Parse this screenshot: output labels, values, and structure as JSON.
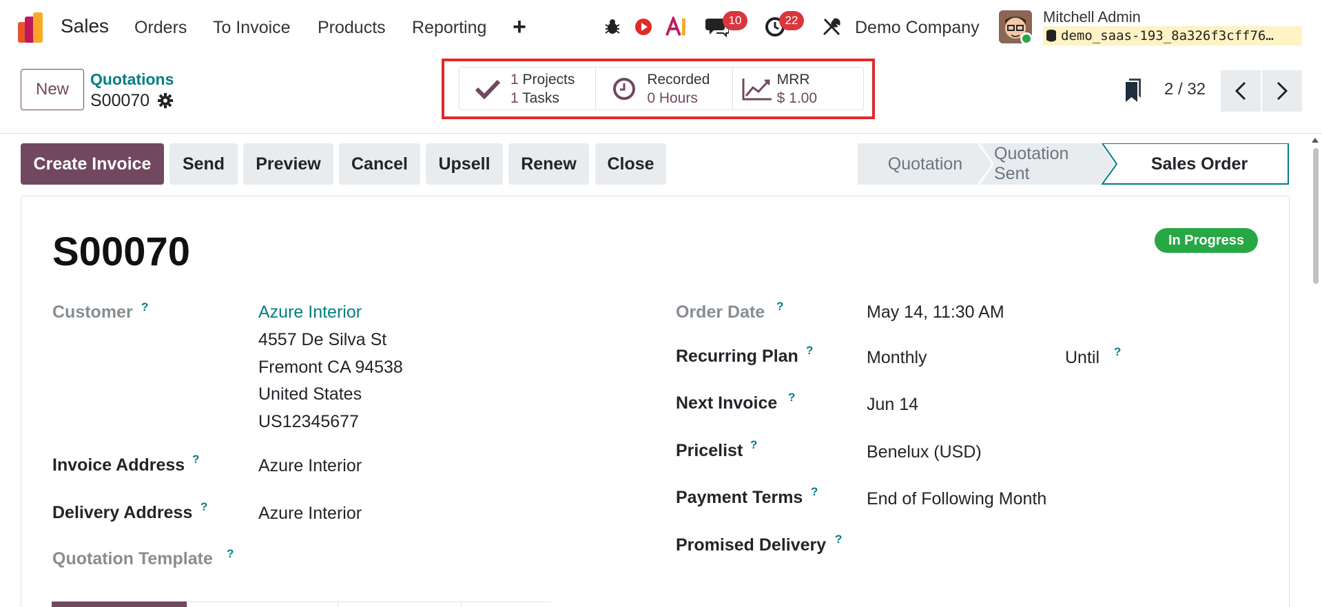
{
  "navbar": {
    "app_name": "Sales",
    "menu": [
      "Orders",
      "To Invoice",
      "Products",
      "Reporting"
    ],
    "plus_icon": "+",
    "messages_count": "10",
    "activities_count": "22",
    "company": "Demo Company",
    "user_name": "Mitchell Admin",
    "database": "demo_saas-193_8a326f3cff76…"
  },
  "control": {
    "new_label": "New",
    "breadcrumb": "Quotations",
    "record_name": "S00070",
    "smart_buttons": {
      "projects": {
        "value": "1",
        "label": "Projects"
      },
      "tasks": {
        "value": "1",
        "label": "Tasks"
      },
      "recorded": {
        "label": "Recorded",
        "value": "0 Hours"
      },
      "mrr": {
        "label": "MRR",
        "value": "$ 1.00"
      }
    },
    "pager": "2 / 32"
  },
  "actions": [
    "Create Invoice",
    "Send",
    "Preview",
    "Cancel",
    "Upsell",
    "Renew",
    "Close"
  ],
  "stages": {
    "s1": "Quotation",
    "s2": "Quotation Sent",
    "s3": "Sales Order"
  },
  "record": {
    "title": "S00070",
    "state": "In Progress",
    "customer": {
      "label": "Customer",
      "name": "Azure Interior",
      "street": "4557 De Silva St",
      "city": "Fremont CA 94538",
      "country": "United States",
      "vat": "US12345677"
    },
    "invoice_address": {
      "label": "Invoice Address",
      "value": "Azure Interior"
    },
    "delivery_address": {
      "label": "Delivery Address",
      "value": "Azure Interior"
    },
    "quotation_template": {
      "label": "Quotation Template"
    },
    "order_date": {
      "label": "Order Date",
      "value": "May 14, 11:30 AM"
    },
    "recurring_plan": {
      "label": "Recurring Plan",
      "value": "Monthly",
      "until_label": "Until"
    },
    "next_invoice": {
      "label": "Next Invoice",
      "value": "Jun 14"
    },
    "pricelist": {
      "label": "Pricelist",
      "value": "Benelux (USD)"
    },
    "payment_terms": {
      "label": "Payment Terms",
      "value": "End of Following Month"
    },
    "promised_delivery": {
      "label": "Promised Delivery"
    },
    "help_mark": "?"
  },
  "colors": {
    "brand": "#71485f",
    "link": "#017e84",
    "badge": "#d9363e",
    "success": "#28a745",
    "highlight": "#e02a2a"
  }
}
